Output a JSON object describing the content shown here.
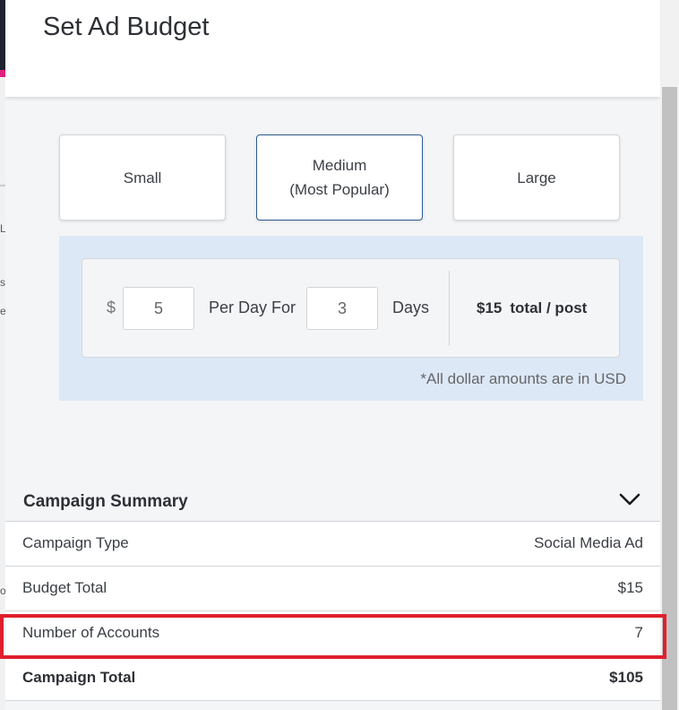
{
  "modal": {
    "title": "Set Ad Budget"
  },
  "size_options": [
    {
      "line1": "Small",
      "line2": ""
    },
    {
      "line1": "Medium",
      "line2": "(Most Popular)"
    },
    {
      "line1": "Large",
      "line2": ""
    }
  ],
  "selected_size": "Medium",
  "budget": {
    "currency_symbol": "$",
    "per_day_value": "5",
    "per_day_label": "Per Day For",
    "days_value": "3",
    "days_label": "Days",
    "total_amount": "$15",
    "total_suffix": "total / post",
    "usd_note": "*All dollar amounts are in USD"
  },
  "summary": {
    "title": "Campaign Summary",
    "rows": [
      {
        "label": "Campaign Type",
        "value": "Social Media Ad"
      },
      {
        "label": "Budget Total",
        "value": "$15"
      },
      {
        "label": "Number of Accounts",
        "value": "7"
      }
    ],
    "total": {
      "label": "Campaign Total",
      "value": "$105"
    }
  },
  "background_fragments": [
    "L",
    "s",
    "e",
    "o"
  ],
  "colors": {
    "selected_border": "#2d5a8c",
    "budget_panel_bg": "#dde8f7",
    "highlight": "#e01f2d"
  }
}
